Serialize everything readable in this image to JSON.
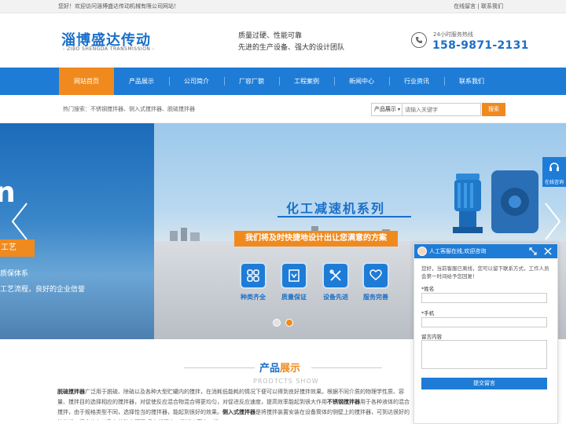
{
  "topbar": {
    "welcome": "您好！欢迎访问淄博盛达传动机械有限公司网站！",
    "links": "在线留言 | 联系我们"
  },
  "header": {
    "logo_cn": "淄博盛达传动",
    "logo_en": "- ZIBO SHENGDA TRANSMISSION -",
    "slogan_line1": "质量过硬、性能可靠",
    "slogan_line2": "先进的生产设备、强大的设计团队",
    "phone_label": "24小时服务热线",
    "phone_number": "158-9871-2131"
  },
  "nav": {
    "items": [
      {
        "label": "网站首页"
      },
      {
        "label": "产品展示"
      },
      {
        "label": "公司简介"
      },
      {
        "label": "厂容厂貌"
      },
      {
        "label": "工程案例"
      },
      {
        "label": "新闻中心"
      },
      {
        "label": "行业资讯"
      },
      {
        "label": "联系我们"
      }
    ]
  },
  "search": {
    "hot_text": "热门搜索：不锈钢搅拌器、侧入式搅拌器、脱硫搅拌器",
    "select_value": "产品展示",
    "input_placeholder": "请输入关键字",
    "button_label": "搜索"
  },
  "banner": {
    "left_big": "n",
    "left_tag": "工艺",
    "left_line1": "质保体系",
    "left_line2": "工艺流程，良好的企业信誉",
    "title": "化工减速机系列",
    "subtitle": "我们将及时快捷地设计出让您满意的方案",
    "features": [
      {
        "label": "种类齐全",
        "icon": "grid-icon"
      },
      {
        "label": "质量保证",
        "icon": "certificate-icon"
      },
      {
        "label": "设备先进",
        "icon": "tools-icon"
      },
      {
        "label": "服务完善",
        "icon": "heart-hand-icon"
      }
    ]
  },
  "side_online": {
    "label": "在线咨询"
  },
  "products_section": {
    "title_part1": "产品",
    "title_part2": "展示",
    "title_en": "PRODTCTS SHOW",
    "desc_bold1": "脱硫搅拌器",
    "desc_text1": "广泛用于脱硫、除硝以及各种大型贮罐内的搅拌，在消耗低能耗的情况下便可以得到良好搅拌效果。根据不同介质的物理学性质、容量、搅拌目的选择相应的搅拌器，对促使反应混合物混合得更均匀，对促进反应速度，提高效率能起到很大作用",
    "desc_bold2": "不锈钢搅拌器",
    "desc_text2": "用于各种液体的混合搅拌，由于规格类型不同，选择恰当的搅拌器，能起到很好的效果。",
    "desc_bold3": "侧入式搅拌器",
    "desc_text3": "是将搅拌装置安装在设备筒体的侧壁上的搅拌器，可到达很好的热传递，混合均匀以及有效防止沉积,具有投资少，消耗功率小，搅"
  },
  "chat": {
    "title": "人工客服在线,欢迎咨询",
    "intro": "您好，当前客服已离线，您可以留下联系方式，工作人员会第一时间给予您回复！",
    "name_label": "*姓名",
    "phone_label": "*手机",
    "message_label": "留言内容",
    "submit_label": "提交留言"
  }
}
